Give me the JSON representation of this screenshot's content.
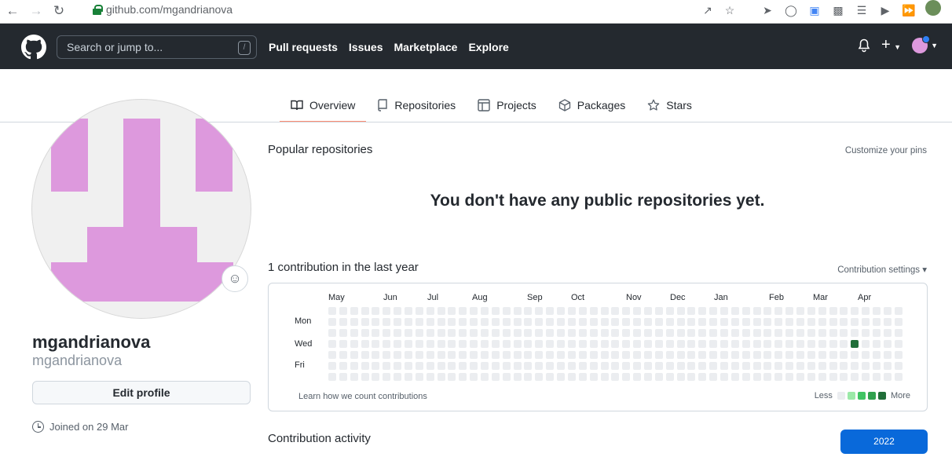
{
  "browser": {
    "url": "github.com/mgandrianova"
  },
  "header": {
    "search_placeholder": "Search or jump to...",
    "search_shortcut": "/",
    "nav": [
      "Pull requests",
      "Issues",
      "Marketplace",
      "Explore"
    ]
  },
  "tabs": [
    {
      "label": "Overview",
      "icon": "book-icon",
      "active": true
    },
    {
      "label": "Repositories",
      "icon": "repo-icon",
      "active": false
    },
    {
      "label": "Projects",
      "icon": "table-icon",
      "active": false
    },
    {
      "label": "Packages",
      "icon": "package-icon",
      "active": false
    },
    {
      "label": "Stars",
      "icon": "star-icon",
      "active": false
    }
  ],
  "profile": {
    "fullname": "mgandrianova",
    "username": "mgandrianova",
    "edit_label": "Edit profile",
    "joined": "Joined on 29 Mar"
  },
  "popular": {
    "title": "Popular repositories",
    "customize": "Customize your pins",
    "empty": "You don't have any public repositories yet."
  },
  "contributions": {
    "title": "1 contribution in the last year",
    "settings": "Contribution settings ▾",
    "months": [
      "May",
      "Jun",
      "Jul",
      "Aug",
      "Sep",
      "Oct",
      "Nov",
      "Dec",
      "Jan",
      "Feb",
      "Mar",
      "Apr"
    ],
    "days": [
      "Mon",
      "Wed",
      "Fri"
    ],
    "learn": "Learn how we count contributions",
    "legend_less": "Less",
    "legend_more": "More",
    "legend_colors": [
      "#ebedf0",
      "#9be9a8",
      "#40c463",
      "#30a14e",
      "#216e39"
    ],
    "weeks": 53,
    "active_cell": {
      "week": 48,
      "day": 3,
      "color": "#216e39"
    }
  },
  "activity": {
    "title": "Contribution activity",
    "year": "2022"
  }
}
